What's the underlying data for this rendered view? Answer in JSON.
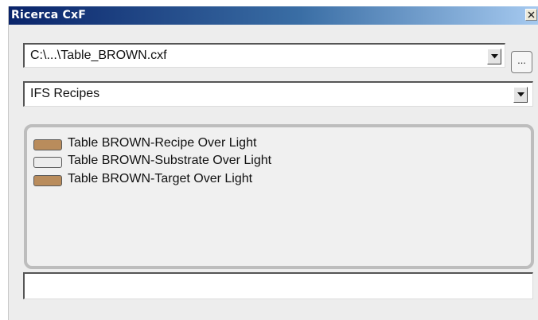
{
  "window": {
    "title": "Ricerca CxF",
    "close_glyph": "×"
  },
  "file_combo": {
    "value": "C:\\...\\Table_BROWN.cxf",
    "icon": "chevron-down-icon"
  },
  "browse_button": {
    "label": "..."
  },
  "recipe_combo": {
    "value": "IFS Recipes",
    "icon": "chevron-down-icon"
  },
  "list": {
    "items": [
      {
        "label": "Table BROWN-Recipe Over Light",
        "swatch_color": "#b98c5c"
      },
      {
        "label": "Table BROWN-Substrate Over Light",
        "swatch_color": "#ececec"
      },
      {
        "label": "Table BROWN-Target Over Light",
        "swatch_color": "#b98c5c"
      }
    ]
  },
  "status_field": {
    "value": ""
  },
  "colors": {
    "title_gradient_start": "#0a246a",
    "title_gradient_end": "#a6caf0",
    "dialog_background": "#ededed"
  }
}
